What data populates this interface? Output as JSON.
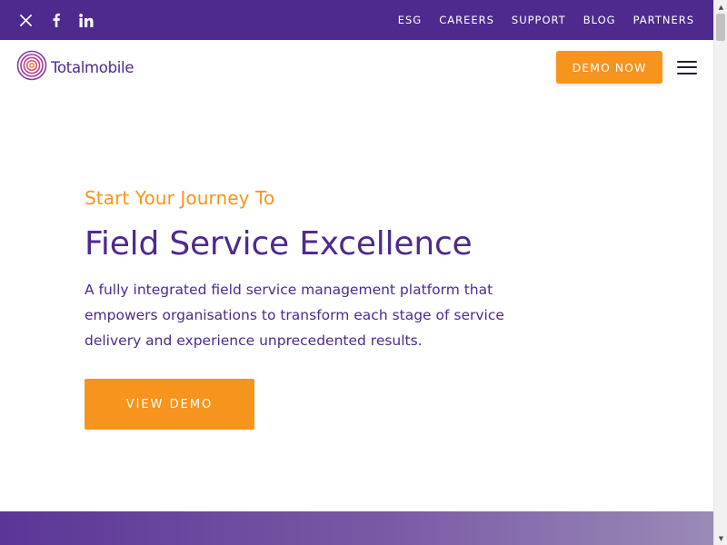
{
  "colors": {
    "brand_purple": "#4e2a8e",
    "accent_orange": "#f7941d"
  },
  "topbar": {
    "social": [
      {
        "icon": "x-twitter-icon"
      },
      {
        "icon": "facebook-icon"
      },
      {
        "icon": "linkedin-icon"
      }
    ],
    "links": [
      {
        "label": "ESG"
      },
      {
        "label": "CAREERS"
      },
      {
        "label": "SUPPORT"
      },
      {
        "label": "BLOG"
      },
      {
        "label": "PARTNERS"
      }
    ]
  },
  "header": {
    "logo_text": "Totalmobile",
    "demo_button": "DEMO NOW",
    "menu_icon": "hamburger-menu-icon"
  },
  "hero": {
    "eyebrow": "Start Your Journey To",
    "headline": "Field Service Excellence",
    "description": "A fully integrated field service management platform that empowers organisations to transform each stage of service delivery and experience unprecedented results.",
    "cta_label": "VIEW DEMO"
  }
}
